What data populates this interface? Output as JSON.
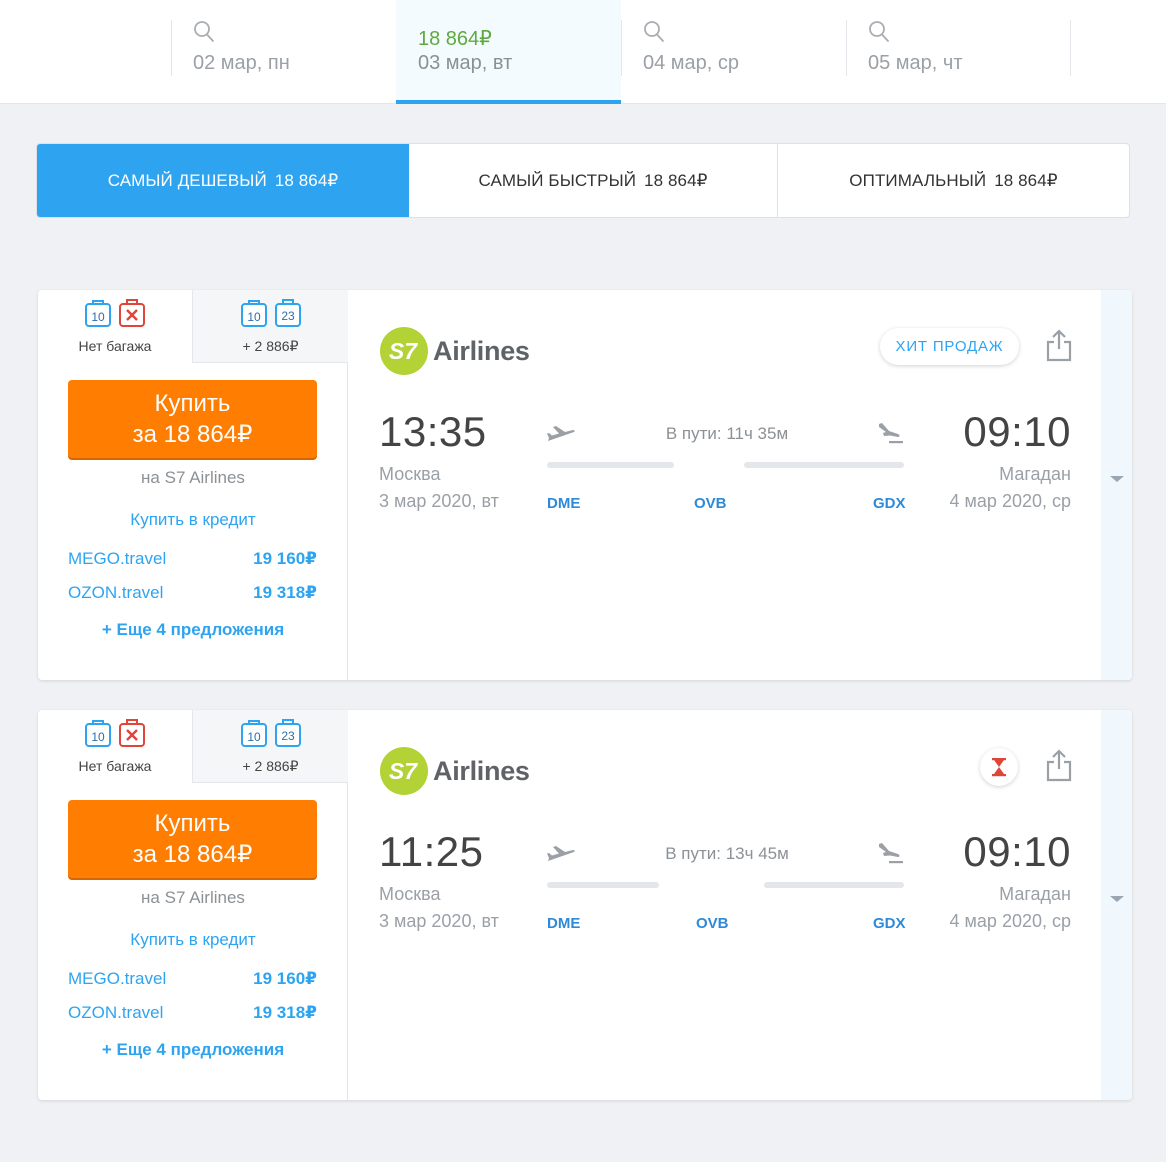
{
  "dates": [
    {
      "label": "02 мар, пн",
      "price": "",
      "active": false
    },
    {
      "label": "03 мар, вт",
      "price": "18 864₽",
      "active": true
    },
    {
      "label": "04 мар, ср",
      "price": "",
      "active": false
    },
    {
      "label": "05 мар, чт",
      "price": "",
      "active": false
    }
  ],
  "sort_tabs": [
    {
      "label": "Самый дешевый",
      "price": "18 864₽",
      "active": true
    },
    {
      "label": "Самый быстрый",
      "price": "18 864₽",
      "active": false
    },
    {
      "label": "Оптимальный",
      "price": "18 864₽",
      "active": false
    }
  ],
  "colors": {
    "accent": "#2ea4f1",
    "buy": "#ff7d00",
    "price_green": "#5fa940",
    "logo_green": "#b2d235"
  },
  "tickets": [
    {
      "baggage": [
        {
          "carry_on": "10",
          "checked": "",
          "label": "Нет багажа"
        },
        {
          "carry_on": "10",
          "checked": "23",
          "label": "+ 2 886₽"
        }
      ],
      "buy_line1": "Купить",
      "buy_line2": "за 18 864₽",
      "seller": "на S7 Airlines",
      "credit": "Купить в кредит",
      "agencies": [
        {
          "name": "MEGO.travel",
          "price": "19 160₽"
        },
        {
          "name": "OZON.travel",
          "price": "19 318₽"
        }
      ],
      "more": "+ Еще 4 предложения",
      "airline_logo_text": "Airlines",
      "badge": "ХИТ ПРОДАЖ",
      "badge_type": "hit",
      "departure": {
        "time": "13:35",
        "city": "Москва",
        "date": "3 мар 2020, вт"
      },
      "arrival": {
        "time": "09:10",
        "city": "Магадан",
        "date": "4 мар 2020, ср"
      },
      "duration": "В пути: 11ч 35м",
      "airports": [
        "DME",
        "OVB",
        "GDX"
      ]
    },
    {
      "baggage": [
        {
          "carry_on": "10",
          "checked": "",
          "label": "Нет багажа"
        },
        {
          "carry_on": "10",
          "checked": "23",
          "label": "+ 2 886₽"
        }
      ],
      "buy_line1": "Купить",
      "buy_line2": "за 18 864₽",
      "seller": "на S7 Airlines",
      "credit": "Купить в кредит",
      "agencies": [
        {
          "name": "MEGO.travel",
          "price": "19 160₽"
        },
        {
          "name": "OZON.travel",
          "price": "19 318₽"
        }
      ],
      "more": "+ Еще 4 предложения",
      "airline_logo_text": "Airlines",
      "badge": "",
      "badge_type": "hourglass-icon",
      "departure": {
        "time": "11:25",
        "city": "Москва",
        "date": "3 мар 2020, вт"
      },
      "arrival": {
        "time": "09:10",
        "city": "Магадан",
        "date": "4 мар 2020, ср"
      },
      "duration": "В пути: 13ч 45м",
      "airports": [
        "DME",
        "OVB",
        "GDX"
      ]
    }
  ]
}
